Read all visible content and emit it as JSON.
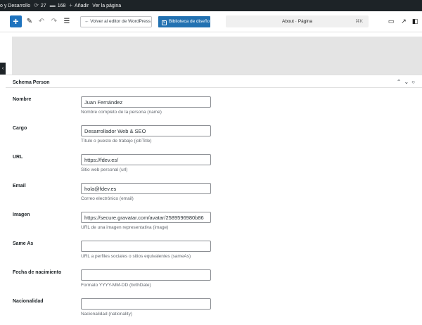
{
  "admin_bar": {
    "site_name": "o y Desarrollo",
    "updates_count": "27",
    "comments_count": "168",
    "new_label": "Añadir",
    "view_page_label": "Ver la página"
  },
  "toolbar": {
    "back_label": "← Volver al editor de WordPress",
    "library_label": "Biblioteca de diseño",
    "command_text": "About · Página",
    "command_shortcut": "⌘K"
  },
  "panel": {
    "title": "Schema Person",
    "fields": [
      {
        "label": "Nombre",
        "value": "Juan Fernández",
        "placeholder": "",
        "description": "Nombre completo de la persona (name)"
      },
      {
        "label": "Cargo",
        "value": "Desarrollador Web & SEO",
        "placeholder": "",
        "description": "Título o puesto de trabajo (jobTitle)"
      },
      {
        "label": "URL",
        "value": "https://fdev.es/",
        "placeholder": "",
        "description": "Sitio web personal (url)"
      },
      {
        "label": "Email",
        "value": "hola@fdev.es",
        "placeholder": "",
        "description": "Correo electrónico (email)"
      },
      {
        "label": "Imagen",
        "value": "https://secure.gravatar.com/avatar/2589596980b86",
        "placeholder": "",
        "description": "URL de una imagen representativa (image)"
      },
      {
        "label": "Same As",
        "value": "",
        "placeholder": "",
        "description": "URL a perfiles sociales o sitios equivalentes (sameAs)"
      },
      {
        "label": "Fecha de nacimiento",
        "value": "",
        "placeholder": "",
        "description": "Formato YYYY-MM-DD (birthDate)"
      },
      {
        "label": "Nacionalidad",
        "value": "",
        "placeholder": "",
        "description": "Nacionalidad (nationality)"
      }
    ]
  },
  "icons": {
    "updates": "refresh-icon",
    "comments": "comment-icon",
    "new": "plus-icon"
  }
}
